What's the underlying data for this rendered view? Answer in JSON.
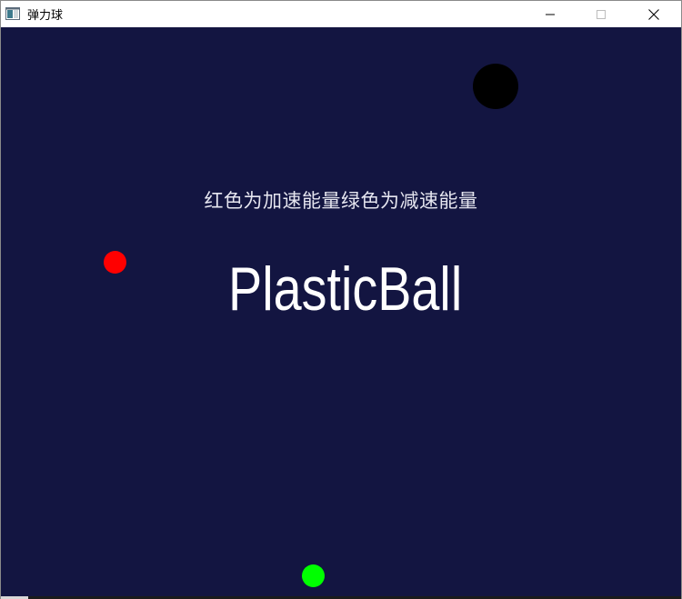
{
  "window": {
    "title": "弹力球",
    "icon": "app-window-icon",
    "controls": [
      "minimize-icon",
      "maximize-icon",
      "close-icon"
    ]
  },
  "game": {
    "hint": "红色为加速能量绿色为减速能量",
    "title": "PlasticBall",
    "background_color": "#131541",
    "balls": [
      {
        "role": "player",
        "color": "#000000"
      },
      {
        "role": "accelerate-energy",
        "color": "#ff0000"
      },
      {
        "role": "decelerate-energy",
        "color": "#00ff00"
      }
    ]
  }
}
